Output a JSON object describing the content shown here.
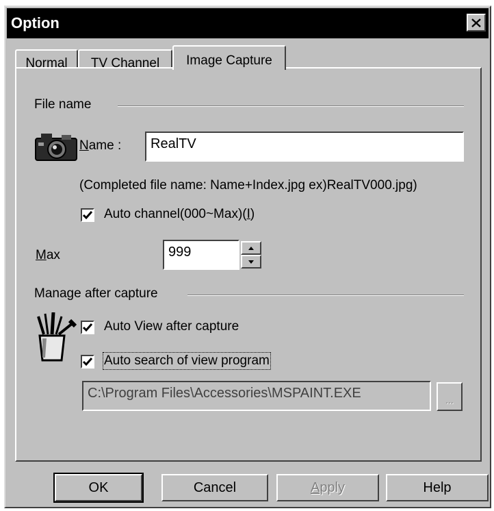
{
  "window": {
    "title": "Option"
  },
  "tabs": [
    {
      "label": "Normal"
    },
    {
      "label": "TV Channel"
    },
    {
      "label": "Image Capture"
    }
  ],
  "file_name": {
    "group_label": "File name",
    "name_label_mnemonic": "N",
    "name_label_rest": "ame :",
    "name_value": "RealTV",
    "hint": "(Completed file name: Name+Index.jpg ex)RealTV000.jpg)",
    "auto_channel_prefix": "Auto channel(000~Max)(",
    "auto_channel_mnemonic": "I",
    "auto_channel_suffix": ")",
    "auto_channel_checked": true,
    "max_label_mnemonic": "M",
    "max_label_rest": "ax",
    "max_value": "999"
  },
  "manage": {
    "group_label": "Manage after capture",
    "auto_view_label": "Auto View after capture",
    "auto_view_checked": true,
    "auto_search_label": "Auto search of view program",
    "auto_search_checked": true,
    "program_path": "C:\\Program Files\\Accessories\\MSPAINT.EXE",
    "browse_label": "..."
  },
  "buttons": {
    "ok": "OK",
    "cancel": "Cancel",
    "apply_mnemonic": "A",
    "apply_rest": "pply",
    "help": "Help"
  }
}
